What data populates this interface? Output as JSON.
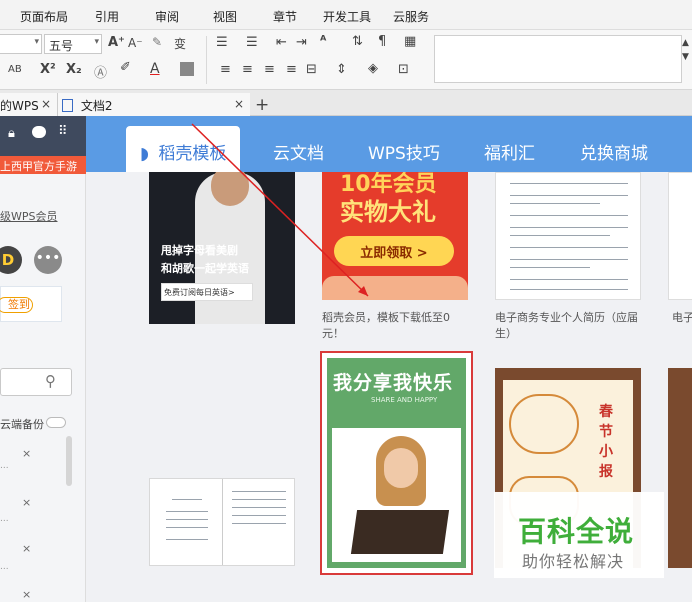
{
  "menu": [
    "页面布局",
    "引用",
    "审阅",
    "视图",
    "章节",
    "开发工具",
    "云服务"
  ],
  "ribbon": {
    "font_size": "五号",
    "grow_font": "A⁺",
    "shrink_font": "A⁻",
    "pinyin": "变",
    "ab": "AB",
    "superscript": "X²",
    "subscript": "X₂",
    "font_color_label": "A"
  },
  "tabs": {
    "first_label": "的WPS",
    "second_label": "文档2",
    "close_symbol": "×",
    "new_symbol": "+"
  },
  "sidebar": {
    "banner": "上西甲官方手游",
    "link": "级WPS会员",
    "avatar_letter": "D",
    "signin": "签到",
    "cloud_backup": "云端备份",
    "close_symbol": "×"
  },
  "nav_tabs": [
    "稻壳模板",
    "云文档",
    "WPS技巧",
    "福利汇",
    "兑换商城"
  ],
  "cards": {
    "english_ad": {
      "line1": "甩掉字母看美剧",
      "line2": "和胡歌一起学英语",
      "button": "免费订阅每日英语>"
    },
    "member_ad": {
      "top": "10年会员",
      "middle": "实物大礼",
      "button": "立即领取 >",
      "caption": "稻壳会员，模板下载低至0元！"
    },
    "resume_caption": "电子商务专业个人简历（应届生）",
    "resume_caption_clipped": "电子",
    "green_card": {
      "title": "我分享我快乐",
      "subtitle": "SHARE AND HAPPY"
    },
    "newspaper": {
      "label": "春节小报"
    }
  },
  "watermark": {
    "title": "百科全说",
    "subtitle": "助你轻松解决"
  },
  "colors": {
    "header_blue": "#5a9be4",
    "accent_red": "#e14b3b",
    "green": "#62a869"
  }
}
